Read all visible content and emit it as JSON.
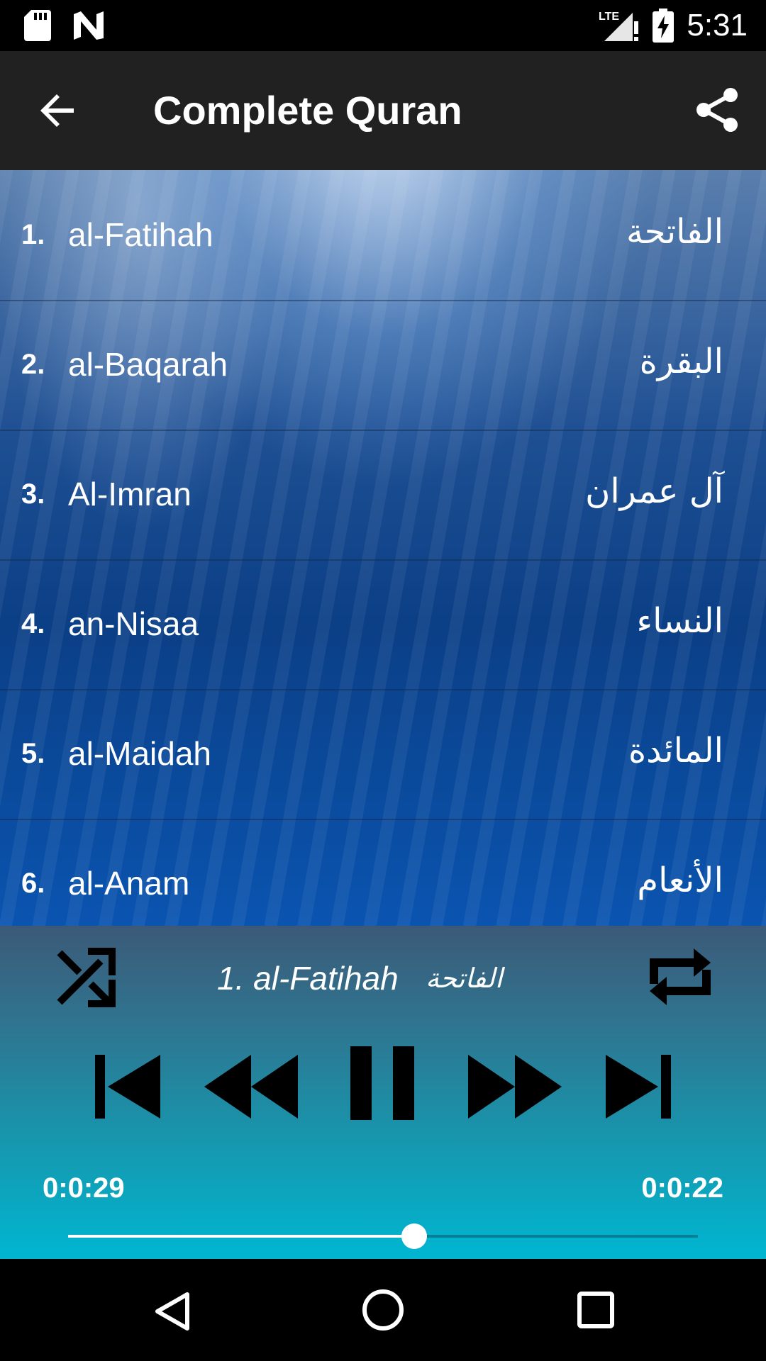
{
  "status_bar": {
    "time": "5:31",
    "network_label": "LTE",
    "icons": [
      "sd-card-icon",
      "n-notification-icon",
      "signal-icon",
      "battery-charging-icon"
    ]
  },
  "app_bar": {
    "title": "Complete Quran",
    "back_icon": "arrow-back-icon",
    "share_icon": "share-icon"
  },
  "surahs": [
    {
      "number": "1.",
      "name": "al-Fatihah",
      "arabic": "الفاتحة"
    },
    {
      "number": "2.",
      "name": "al-Baqarah",
      "arabic": "البقرة"
    },
    {
      "number": "3.",
      "name": "Al-Imran",
      "arabic": "آل عمران"
    },
    {
      "number": "4.",
      "name": "an-Nisaa",
      "arabic": "النساء"
    },
    {
      "number": "5.",
      "name": "al-Maidah",
      "arabic": "المائدة"
    },
    {
      "number": "6.",
      "name": "al-Anam",
      "arabic": "الأنعام"
    }
  ],
  "player": {
    "now_playing_title": "1. al-Fatihah",
    "now_playing_arabic": "الفاتحة",
    "elapsed": "0:0:29",
    "remaining": "0:0:22",
    "progress_fraction": 0.55,
    "controls": [
      "shuffle-icon",
      "repeat-icon",
      "skip-previous-icon",
      "rewind-icon",
      "pause-icon",
      "fast-forward-icon",
      "skip-next-icon"
    ]
  },
  "nav_bar": {
    "icons": [
      "nav-back-icon",
      "nav-home-icon",
      "nav-recents-icon"
    ]
  }
}
